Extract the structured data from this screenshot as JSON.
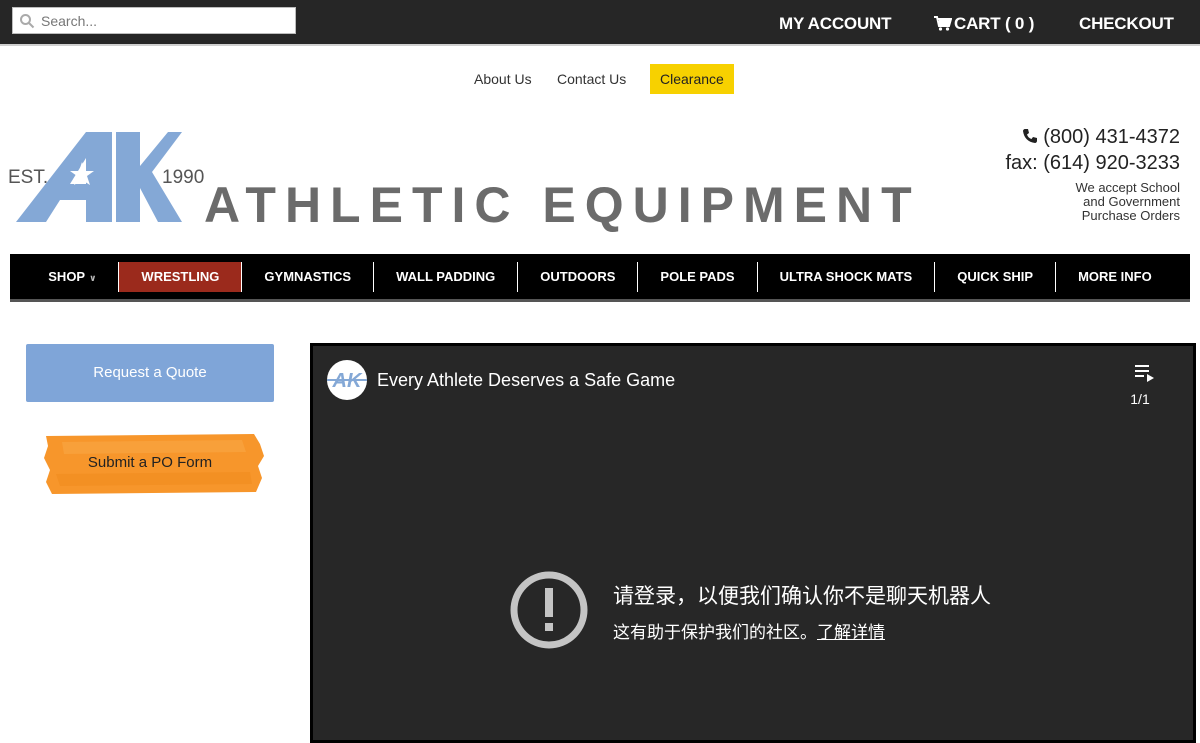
{
  "topbar": {
    "search_placeholder": "Search...",
    "my_account": "MY ACCOUNT",
    "cart": "CART ( 0 )",
    "checkout": "CHECKOUT"
  },
  "utility_links": {
    "about": "About Us",
    "contact": "Contact Us",
    "clearance": "Clearance"
  },
  "brand": {
    "est": "EST.",
    "year": "1990",
    "logo_letters": "AK",
    "name": "ATHLETIC EQUIPMENT",
    "colors": {
      "logo_blue": "#84a8d6",
      "text_gray": "#6b6b6b"
    }
  },
  "contact": {
    "phone": "(800) 431-4372",
    "fax": "fax: (614) 920-3233",
    "accept_line1": "We accept School",
    "accept_line2": "and Government",
    "accept_line3": "Purchase Orders"
  },
  "nav": {
    "items": [
      {
        "label": "SHOP"
      },
      {
        "label": "WRESTLING"
      },
      {
        "label": "GYMNASTICS"
      },
      {
        "label": "WALL PADDING"
      },
      {
        "label": "OUTDOORS"
      },
      {
        "label": "POLE PADS"
      },
      {
        "label": "ULTRA SHOCK MATS"
      },
      {
        "label": "QUICK SHIP"
      },
      {
        "label": "MORE INFO"
      }
    ],
    "active_color": "#9b2a1c"
  },
  "sidebar": {
    "quote_button": "Request a Quote",
    "po_button": "Submit a PO Form"
  },
  "video": {
    "channel_badge": "AK",
    "title": "Every Athlete Deserves a Safe Game",
    "playlist_count": "1/1",
    "message": "请登录，以便我们确认你不是聊天机器人",
    "sub_message": "这有助于保护我们的社区。",
    "learn_more": "了解详情"
  }
}
